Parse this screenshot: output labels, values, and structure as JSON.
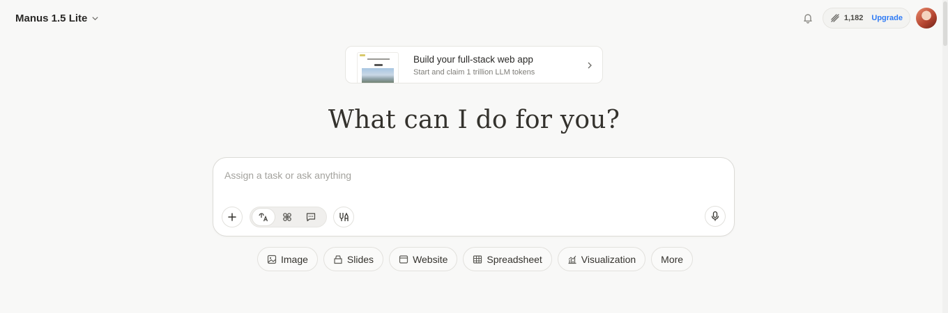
{
  "header": {
    "model_name": "Manus 1.5 Lite",
    "credits": "1,182",
    "upgrade_label": "Upgrade"
  },
  "promo": {
    "title": "Build your full-stack web app",
    "subtitle": "Start and claim 1 trillion LLM tokens"
  },
  "main": {
    "headline": "What can I do for you?"
  },
  "composer": {
    "placeholder": "Assign a task or ask anything",
    "value": ""
  },
  "chips": [
    {
      "label": "Image",
      "icon": "image-icon"
    },
    {
      "label": "Slides",
      "icon": "slides-icon"
    },
    {
      "label": "Website",
      "icon": "website-icon"
    },
    {
      "label": "Spreadsheet",
      "icon": "spreadsheet-icon"
    },
    {
      "label": "Visualization",
      "icon": "visualization-icon"
    },
    {
      "label": "More",
      "icon": ""
    }
  ],
  "colors": {
    "background": "#f8f8f7",
    "accent": "#2f7bf5",
    "text": "#34322d"
  }
}
